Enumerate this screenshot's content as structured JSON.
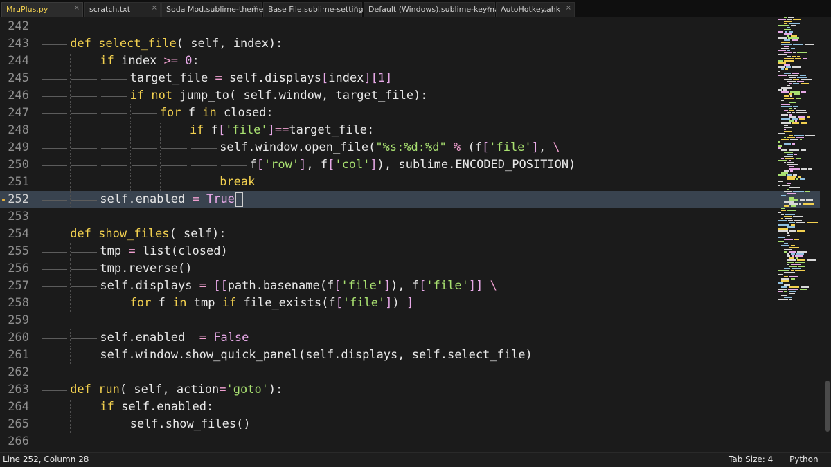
{
  "tabs": [
    {
      "label": "MruPlus.py",
      "active": true,
      "close": "×"
    },
    {
      "label": "scratch.txt",
      "active": false,
      "close": "×"
    },
    {
      "label": "Soda Mod.sublime-theme",
      "active": false,
      "close": "×"
    },
    {
      "label": "Base File.sublime-settings",
      "active": false,
      "close": "×"
    },
    {
      "label": "Default (Windows).sublime-keymap",
      "active": false,
      "close": "×"
    },
    {
      "label": "AutoHotkey.ahk",
      "active": false,
      "close": "×"
    }
  ],
  "editor": {
    "current_line": 252,
    "lines": [
      {
        "n": "242",
        "indent": 0,
        "tokens": []
      },
      {
        "n": "243",
        "indent": 1,
        "tokens": [
          [
            "kw",
            "def"
          ],
          [
            "s",
            " "
          ],
          [
            "kw",
            "select_file"
          ],
          [
            "paren",
            "("
          ],
          [
            "s",
            " "
          ],
          [
            "ident",
            "self"
          ],
          [
            "paren",
            ","
          ],
          [
            "s",
            " "
          ],
          [
            "ident",
            "index"
          ],
          [
            "paren",
            "):"
          ]
        ]
      },
      {
        "n": "244",
        "indent": 2,
        "tokens": [
          [
            "kw",
            "if"
          ],
          [
            "s",
            " "
          ],
          [
            "ident",
            "index"
          ],
          [
            "s",
            " "
          ],
          [
            "op",
            ">="
          ],
          [
            "s",
            " "
          ],
          [
            "num",
            "0"
          ],
          [
            "ident",
            ":"
          ]
        ]
      },
      {
        "n": "245",
        "indent": 3,
        "tokens": [
          [
            "ident",
            "target_file"
          ],
          [
            "s",
            " "
          ],
          [
            "op",
            "="
          ],
          [
            "s",
            " "
          ],
          [
            "ident",
            "self.displays"
          ],
          [
            "bracket",
            "["
          ],
          [
            "ident",
            "index"
          ],
          [
            "bracket",
            "]["
          ],
          [
            "num",
            "1"
          ],
          [
            "bracket",
            "]"
          ]
        ]
      },
      {
        "n": "246",
        "indent": 3,
        "tokens": [
          [
            "kw",
            "if"
          ],
          [
            "s",
            " "
          ],
          [
            "kw",
            "not"
          ],
          [
            "s",
            " "
          ],
          [
            "ident",
            "jump_to"
          ],
          [
            "paren",
            "("
          ],
          [
            "s",
            " "
          ],
          [
            "ident",
            "self.window"
          ],
          [
            "paren",
            ","
          ],
          [
            "s",
            " "
          ],
          [
            "ident",
            "target_file"
          ],
          [
            "paren",
            "):"
          ]
        ]
      },
      {
        "n": "247",
        "indent": 4,
        "tokens": [
          [
            "kw",
            "for"
          ],
          [
            "s",
            " "
          ],
          [
            "ident",
            "f"
          ],
          [
            "s",
            " "
          ],
          [
            "kw",
            "in"
          ],
          [
            "s",
            " "
          ],
          [
            "ident",
            "closed:"
          ]
        ]
      },
      {
        "n": "248",
        "indent": 5,
        "tokens": [
          [
            "kw",
            "if"
          ],
          [
            "s",
            " "
          ],
          [
            "ident",
            "f"
          ],
          [
            "bracket",
            "["
          ],
          [
            "str",
            "'file'"
          ],
          [
            "bracket",
            "]"
          ],
          [
            "op",
            "=="
          ],
          [
            "ident",
            "target_file:"
          ]
        ]
      },
      {
        "n": "249",
        "indent": 6,
        "tokens": [
          [
            "ident",
            "self.window.open_file"
          ],
          [
            "paren",
            "("
          ],
          [
            "str",
            "\"%s:%d:%d\""
          ],
          [
            "s",
            " "
          ],
          [
            "op",
            "%"
          ],
          [
            "s",
            " "
          ],
          [
            "paren",
            "("
          ],
          [
            "ident",
            "f"
          ],
          [
            "bracket",
            "["
          ],
          [
            "str",
            "'file'"
          ],
          [
            "bracket",
            "]"
          ],
          [
            "paren",
            ","
          ],
          [
            "s",
            " "
          ],
          [
            "op",
            "\\"
          ]
        ]
      },
      {
        "n": "250",
        "indent": 7,
        "tokens": [
          [
            "ident",
            "f"
          ],
          [
            "bracket",
            "["
          ],
          [
            "str",
            "'row'"
          ],
          [
            "bracket",
            "]"
          ],
          [
            "paren",
            ","
          ],
          [
            "s",
            " "
          ],
          [
            "ident",
            "f"
          ],
          [
            "bracket",
            "["
          ],
          [
            "str",
            "'col'"
          ],
          [
            "bracket",
            "]"
          ],
          [
            "paren",
            "),"
          ],
          [
            "s",
            " "
          ],
          [
            "ident",
            "sublime.ENCODED_POSITION"
          ],
          [
            "paren",
            ")"
          ]
        ]
      },
      {
        "n": "251",
        "indent": 6,
        "tokens": [
          [
            "kw",
            "break"
          ]
        ]
      },
      {
        "n": "252",
        "indent": 2,
        "tokens": [
          [
            "ident",
            "self.enabled"
          ],
          [
            "s",
            " "
          ],
          [
            "op",
            "="
          ],
          [
            "s",
            " "
          ],
          [
            "bool",
            "True"
          ]
        ]
      },
      {
        "n": "253",
        "indent": 0,
        "tokens": []
      },
      {
        "n": "254",
        "indent": 1,
        "tokens": [
          [
            "kw",
            "def"
          ],
          [
            "s",
            " "
          ],
          [
            "kw",
            "show_files"
          ],
          [
            "paren",
            "("
          ],
          [
            "s",
            " "
          ],
          [
            "ident",
            "self"
          ],
          [
            "paren",
            "):"
          ]
        ]
      },
      {
        "n": "255",
        "indent": 2,
        "tokens": [
          [
            "ident",
            "tmp"
          ],
          [
            "s",
            " "
          ],
          [
            "op",
            "="
          ],
          [
            "s",
            " "
          ],
          [
            "ident",
            "list"
          ],
          [
            "paren",
            "("
          ],
          [
            "ident",
            "closed"
          ],
          [
            "paren",
            ")"
          ]
        ]
      },
      {
        "n": "256",
        "indent": 2,
        "tokens": [
          [
            "ident",
            "tmp.reverse"
          ],
          [
            "paren",
            "()"
          ]
        ]
      },
      {
        "n": "257",
        "indent": 2,
        "tokens": [
          [
            "ident",
            "self.displays"
          ],
          [
            "s",
            " "
          ],
          [
            "op",
            "="
          ],
          [
            "s",
            " "
          ],
          [
            "bracket",
            "[["
          ],
          [
            "ident",
            "path.basename"
          ],
          [
            "paren",
            "("
          ],
          [
            "ident",
            "f"
          ],
          [
            "bracket",
            "["
          ],
          [
            "str",
            "'file'"
          ],
          [
            "bracket",
            "]"
          ],
          [
            "paren",
            "),"
          ],
          [
            "s",
            " "
          ],
          [
            "ident",
            "f"
          ],
          [
            "bracket",
            "["
          ],
          [
            "str",
            "'file'"
          ],
          [
            "bracket",
            "]]"
          ],
          [
            "s",
            " "
          ],
          [
            "op",
            "\\"
          ]
        ]
      },
      {
        "n": "258",
        "indent": 3,
        "tokens": [
          [
            "kw",
            "for"
          ],
          [
            "s",
            " "
          ],
          [
            "ident",
            "f"
          ],
          [
            "s",
            " "
          ],
          [
            "kw",
            "in"
          ],
          [
            "s",
            " "
          ],
          [
            "ident",
            "tmp"
          ],
          [
            "s",
            " "
          ],
          [
            "kw",
            "if"
          ],
          [
            "s",
            " "
          ],
          [
            "ident",
            "file_exists"
          ],
          [
            "paren",
            "("
          ],
          [
            "ident",
            "f"
          ],
          [
            "bracket",
            "["
          ],
          [
            "str",
            "'file'"
          ],
          [
            "bracket",
            "]"
          ],
          [
            "paren",
            ")"
          ],
          [
            "s",
            " "
          ],
          [
            "bracket",
            "]"
          ]
        ]
      },
      {
        "n": "259",
        "indent": 0,
        "tokens": []
      },
      {
        "n": "260",
        "indent": 2,
        "tokens": [
          [
            "ident",
            "self.enabled"
          ],
          [
            "s",
            "  "
          ],
          [
            "op",
            "="
          ],
          [
            "s",
            " "
          ],
          [
            "bool",
            "False"
          ]
        ]
      },
      {
        "n": "261",
        "indent": 2,
        "tokens": [
          [
            "ident",
            "self.window.show_quick_panel"
          ],
          [
            "paren",
            "("
          ],
          [
            "ident",
            "self.displays"
          ],
          [
            "paren",
            ","
          ],
          [
            "s",
            " "
          ],
          [
            "ident",
            "self.select_file"
          ],
          [
            "paren",
            ")"
          ]
        ]
      },
      {
        "n": "262",
        "indent": 0,
        "tokens": []
      },
      {
        "n": "263",
        "indent": 1,
        "tokens": [
          [
            "kw",
            "def"
          ],
          [
            "s",
            " "
          ],
          [
            "kw",
            "run"
          ],
          [
            "paren",
            "("
          ],
          [
            "s",
            " "
          ],
          [
            "ident",
            "self"
          ],
          [
            "paren",
            ","
          ],
          [
            "s",
            " "
          ],
          [
            "ident",
            "action"
          ],
          [
            "op",
            "="
          ],
          [
            "str",
            "'goto'"
          ],
          [
            "paren",
            "):"
          ]
        ]
      },
      {
        "n": "264",
        "indent": 2,
        "tokens": [
          [
            "kw",
            "if"
          ],
          [
            "s",
            " "
          ],
          [
            "ident",
            "self.enabled:"
          ]
        ]
      },
      {
        "n": "265",
        "indent": 3,
        "tokens": [
          [
            "ident",
            "self.show_files"
          ],
          [
            "paren",
            "()"
          ]
        ]
      },
      {
        "n": "266",
        "indent": 0,
        "tokens": []
      }
    ]
  },
  "statusbar": {
    "position": "Line 252, Column 28",
    "tab_size": "Tab Size: 4",
    "syntax": "Python"
  },
  "colors": {
    "background": "#1b1b1b",
    "keyword": "#f2d04f",
    "string": "#a8e070",
    "number": "#e7a9e7",
    "operator": "#f0a0d0",
    "line_highlight": "#39434f",
    "active_tab_text": "#f2d04f"
  }
}
